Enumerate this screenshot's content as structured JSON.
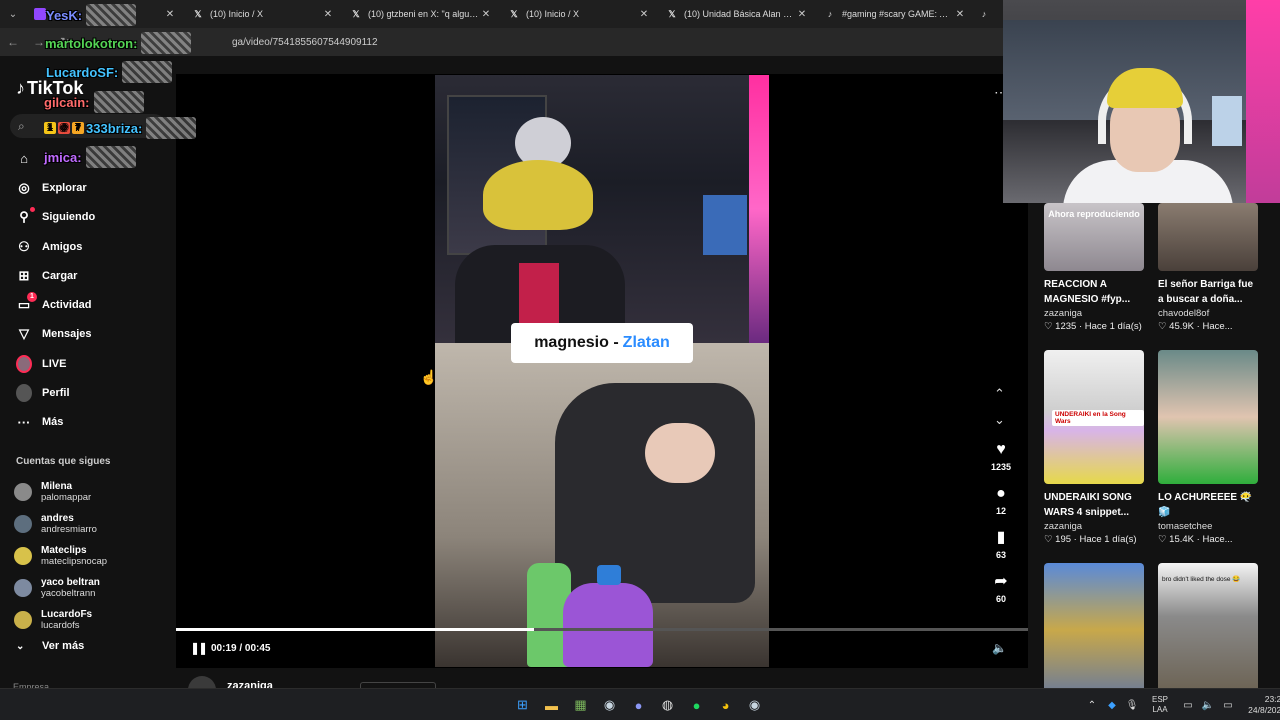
{
  "browser": {
    "tabs": [
      {
        "title": "",
        "icon": "tab-overflow-icon"
      },
      {
        "title": "(10) Inicio / X",
        "icon": "x-logo-icon"
      },
      {
        "title": "(10) gtzbeni en X: \"q alguien m",
        "icon": "x-logo-icon"
      },
      {
        "title": "(10) Inicio / X",
        "icon": "x-logo-icon"
      },
      {
        "title": "(10) Unidad Básica Alan Gauto",
        "icon": "x-logo-icon"
      },
      {
        "title": "#gaming #scary GAME: AAU | g",
        "icon": "tiktok-icon"
      },
      {
        "title": "R",
        "icon": "tiktok-icon"
      }
    ],
    "url": "ga/video/7541855607544909112"
  },
  "chat": [
    {
      "user": "YesK:",
      "color": "#7a8cff"
    },
    {
      "user": "martolokotron:",
      "color": "#55d455"
    },
    {
      "user": "LucardoSF:",
      "color": "#44c3ff"
    },
    {
      "user": "gilcain:",
      "color": "#ff6b6b"
    },
    {
      "user": "333briza:",
      "color": "#44c3ff",
      "badges": [
        "1",
        "@",
        "7"
      ]
    },
    {
      "user": "jmica:",
      "color": "#c06bff"
    }
  ],
  "sidebar": {
    "logo": "TikTok",
    "search_placeholder": "",
    "items": [
      {
        "label": "",
        "icon": "home-icon"
      },
      {
        "label": "Explorar",
        "icon": "compass-icon"
      },
      {
        "label": "Siguiendo",
        "icon": "following-icon"
      },
      {
        "label": "Amigos",
        "icon": "friends-icon"
      },
      {
        "label": "Cargar",
        "icon": "upload-icon"
      },
      {
        "label": "Actividad",
        "icon": "activity-icon",
        "badge": "1"
      },
      {
        "label": "Mensajes",
        "icon": "messages-icon"
      },
      {
        "label": "LIVE",
        "icon": "live-avatar-icon"
      },
      {
        "label": "Perfil",
        "icon": "profile-avatar-icon"
      },
      {
        "label": "Más",
        "icon": "more-icon"
      }
    ],
    "following_title": "Cuentas que sigues",
    "following": [
      {
        "name": "Milena",
        "handle": "palomappar",
        "color": "#8a8a8a"
      },
      {
        "name": "andres",
        "handle": "andresmiarro",
        "color": "#5d6e7e"
      },
      {
        "name": "Mateclips",
        "handle": "mateclipsnocap",
        "color": "#d8c24a"
      },
      {
        "name": "yaco beltran",
        "handle": "yacobeltrann",
        "color": "#7d8aa0"
      },
      {
        "name": "LucardoFs",
        "handle": "lucardofs",
        "color": "#c9b04a"
      }
    ],
    "see_more": "Ver más",
    "footer": "Empresa"
  },
  "video": {
    "caption_main": "magnesio -",
    "caption_highlight": "Zlatan",
    "time_current": "00:19",
    "time_total": "00:45",
    "progress": 0.42,
    "author": "zazaniga",
    "likes": "1235",
    "comments": "12",
    "saves": "63",
    "shares": "60"
  },
  "suggestions": [
    {
      "title": "REACCION A MAGNESIO #fyp...",
      "author": "zazaniga",
      "likes": "1235",
      "time": "Hace 1 día(s)",
      "playing": "Ahora reproduciendo",
      "bg": "linear-gradient(180deg,#c8c4c8,#8e8890)"
    },
    {
      "title": "El señor Barriga fue a buscar a doña...",
      "author": "chavodel8of",
      "likes": "45.9K",
      "time": "Hace...",
      "playing": "",
      "bg": "linear-gradient(180deg,#8a7c70,#4a403a)"
    },
    {
      "title": "UNDERAIKI SONG WARS 4 snippet...",
      "author": "zazaniga",
      "likes": "195",
      "time": "Hace 1 día(s)",
      "playing": "",
      "bg": "linear-gradient(180deg,#f0f0f0 0%,#cfcfcf 45%,#d8b4e8 60%,#e6d94a 100%)",
      "label": "UNDERAIKI en la Song Wars"
    },
    {
      "title": "LO ACHUREEEE 😶‍🌫️🧊",
      "author": "tomasetchee",
      "likes": "15.4K",
      "time": "Hace...",
      "playing": "",
      "bg": "linear-gradient(180deg,#6a8a88 0%,#e0c4b0 50%,#2fae3c 100%)"
    },
    {
      "title": "",
      "author": "",
      "likes": "",
      "time": "",
      "playing": "",
      "bg": "linear-gradient(180deg,#5a8ad8 0%,#c8a84a 50%,#6a7a9a 100%)"
    },
    {
      "title": "",
      "author": "",
      "likes": "",
      "time": "",
      "playing": "",
      "bg": "linear-gradient(180deg,#f4f4f4 0%,#8a8a8a 40%,#6a6050 100%)",
      "label": "bro didn't liked the dose 😂"
    }
  ],
  "taskbar": {
    "icons": [
      "windows-start-icon",
      "file-explorer-icon",
      "minecraft-icon",
      "steam-icon",
      "discord-icon",
      "obs-icon",
      "spotify-icon",
      "chrome-icon",
      "steam-client-icon"
    ],
    "lang_1": "ESP",
    "lang_2": "LAA",
    "time": "23:26",
    "date": "24/8/2025"
  },
  "colors": {
    "accent": "#fe2c55",
    "caption_highlight": "#2b8cff",
    "sidebar_bg": "#121212"
  }
}
